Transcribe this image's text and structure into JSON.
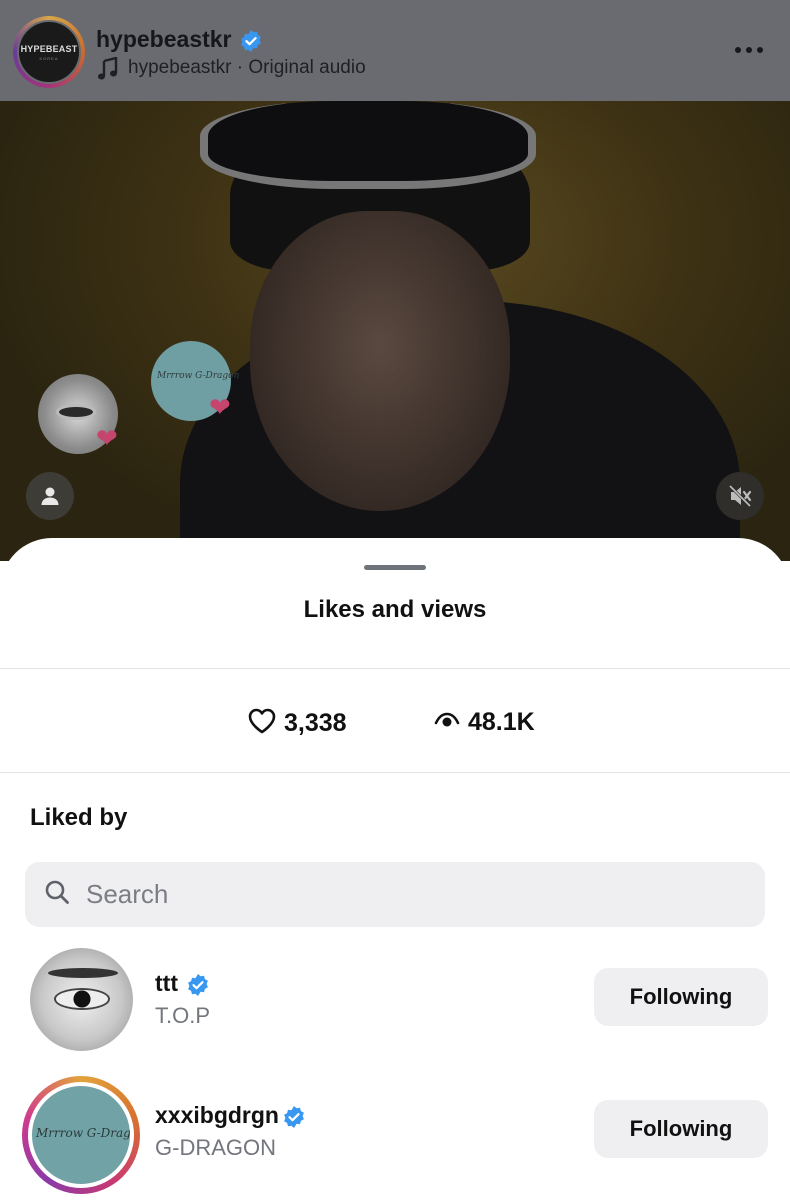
{
  "post": {
    "username": "hypebeastkr",
    "avatar_logo": "HYPEBEAST",
    "avatar_logo_sub": "KOREA",
    "audio_label": "hypebeastkr · Original audio",
    "icons": [
      "verified-badge-icon",
      "music-note-icon",
      "more-options-icon",
      "profile-icon",
      "muted-speaker-icon",
      "heart-icon"
    ],
    "bubble_signature": "Mrrrow G-Dragon"
  },
  "sheet": {
    "title": "Likes and views",
    "likes_count": "3,338",
    "views_count": "48.1K",
    "liked_by_label": "Liked by",
    "search_placeholder": "Search"
  },
  "users": [
    {
      "username": "ttt",
      "full_name": "T.O.P",
      "verified": true,
      "button_label": "Following"
    },
    {
      "username": "xxxibgdrgn",
      "full_name": "G-DRAGON",
      "verified": true,
      "button_label": "Following",
      "avatar_signature": "Mrrrow G-Dragon"
    }
  ],
  "colors": {
    "verified_blue": "#3897f0",
    "button_bg": "#efeff2",
    "secondary_text": "#73767d"
  }
}
